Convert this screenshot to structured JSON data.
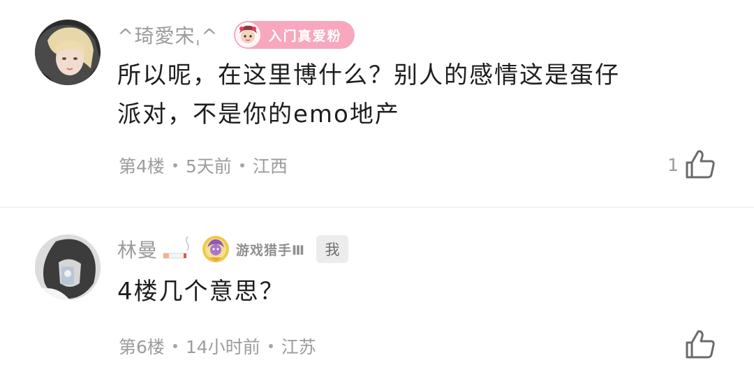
{
  "comments": [
    {
      "username": "^琦愛宋ˌ^",
      "fan_badge": "入门真爱粉",
      "text_line1": "所以呢，在这里博什么？别人的感情这是蛋仔",
      "text_line2": "派对，不是你的emo地产",
      "floor": "第4楼",
      "time": "5天前",
      "location": "江西",
      "likes": "1",
      "like_icon": "thumbs-up-icon"
    },
    {
      "username": "林曼",
      "title": "游戏猎手Ⅲ",
      "me_tag": "我",
      "text_line1": "4楼几个意思？",
      "floor": "第6楼",
      "time": "14小时前",
      "location": "江苏",
      "likes": "",
      "like_icon": "thumbs-up-icon"
    }
  ],
  "colors": {
    "fan_badge_bg": "#f7a8be",
    "username": "#9b9b9b",
    "text": "#1e1e1e",
    "meta": "#9c9c9c",
    "me_tag_bg": "#ececec"
  }
}
